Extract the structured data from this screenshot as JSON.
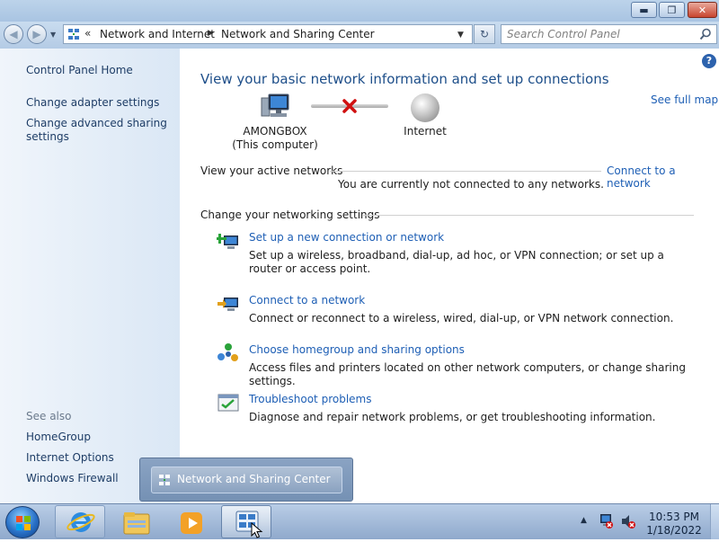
{
  "window": {
    "controls": {
      "minimize": "▬",
      "maximize": "❐",
      "close": "✕"
    }
  },
  "address_bar": {
    "back": "◀",
    "forward": "▶",
    "overflow": "«",
    "breadcrumbs": [
      "Network and Internet",
      "Network and Sharing Center"
    ],
    "refresh": "↻",
    "search_placeholder": "Search Control Panel"
  },
  "sidebar": {
    "home": "Control Panel Home",
    "items": [
      "Change adapter settings",
      "Change advanced sharing settings"
    ],
    "see_also_heading": "See also",
    "see_also": [
      "HomeGroup",
      "Internet Options",
      "Windows Firewall"
    ]
  },
  "main": {
    "title": "View your basic network information and set up connections",
    "see_full_map": "See full map",
    "help": "?",
    "map": {
      "computer_name": "AMONGBOX",
      "computer_sub": "(This computer)",
      "internet_label": "Internet",
      "status": "disconnected"
    },
    "active_networks_label": "View your active networks",
    "connect_to_network_link": "Connect to a network",
    "not_connected_text": "You are currently not connected to any networks.",
    "change_settings_label": "Change your networking settings",
    "tasks": [
      {
        "link": "Set up a new connection or network",
        "description": "Set up a wireless, broadband, dial-up, ad hoc, or VPN connection; or set up a router or access point.",
        "icon": "new-connection-icon"
      },
      {
        "link": "Connect to a network",
        "description": "Connect or reconnect to a wireless, wired, dial-up, or VPN network connection.",
        "icon": "connect-network-icon"
      },
      {
        "link": "Choose homegroup and sharing options",
        "description": "Access files and printers located on other network computers, or change sharing settings.",
        "icon": "homegroup-icon"
      },
      {
        "link": "Troubleshoot problems",
        "description": "Diagnose and repair network problems, or get troubleshooting information.",
        "icon": "troubleshoot-icon"
      }
    ]
  },
  "taskbar": {
    "thumbnail_label": "Network and Sharing Center",
    "pinned": [
      "internet-explorer-icon",
      "windows-explorer-icon",
      "media-player-icon",
      "network-center-icon"
    ],
    "tray_arrow": "▲",
    "clock_time": "10:53 PM",
    "clock_date": "1/18/2022"
  },
  "colors": {
    "link": "#1e5fb5",
    "title": "#1e4f8a",
    "sidebar_bg": "#dae7f5",
    "taskbar_bg": "#a7bedd",
    "error_red": "#d01010"
  }
}
